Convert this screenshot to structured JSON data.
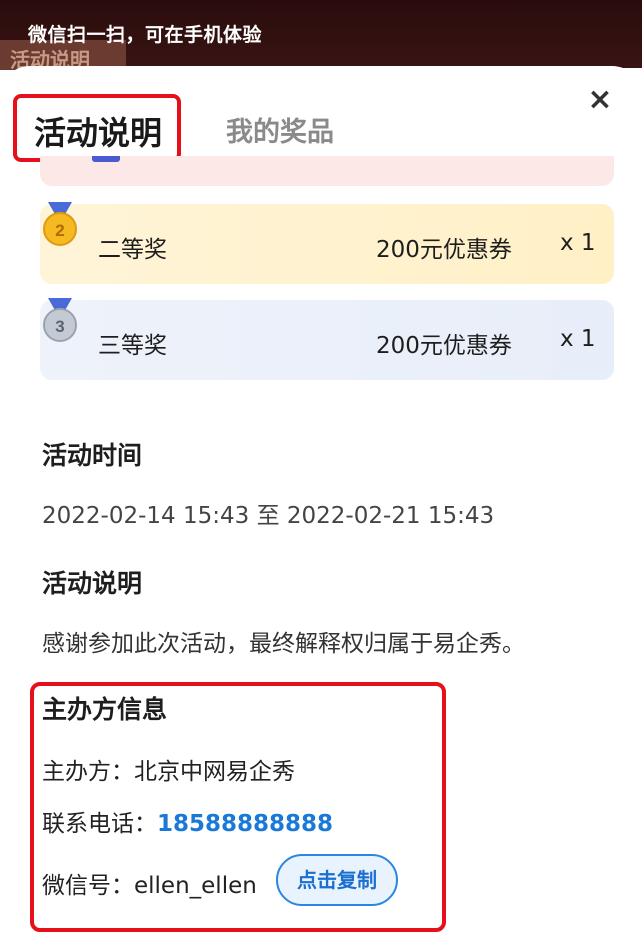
{
  "topbar": {
    "hint": "微信扫一扫，可在手机体验",
    "bg_peek": "活动说明"
  },
  "tabs": [
    {
      "label": "活动说明",
      "active": true
    },
    {
      "label": "我的奖品",
      "active": false
    }
  ],
  "close_glyph": "×",
  "prizes": [
    {
      "rank": "2",
      "name": "二等奖",
      "value": "200元优惠券",
      "qty": "x 1",
      "icon": "silver-medal-icon",
      "medal_color": "#f5b921"
    },
    {
      "rank": "3",
      "name": "三等奖",
      "value": "200元优惠券",
      "qty": "x 1",
      "icon": "bronze-medal-icon",
      "medal_color": "#b9c0cc"
    }
  ],
  "activity_time": {
    "title": "活动时间",
    "value": "2022-02-14 15:43 至 2022-02-21 15:43"
  },
  "activity_desc": {
    "title": "活动说明",
    "value": "感谢参加此次活动，最终解释权归属于易企秀。"
  },
  "host": {
    "title": "主办方信息",
    "org_label": "主办方：",
    "org_value": "北京中网易企秀",
    "phone_label": "联系电话：",
    "phone_value": "18588888888",
    "wechat_label": "微信号：",
    "wechat_value": "ellen_ellen",
    "copy_label": "点击复制"
  },
  "colors": {
    "highlight": "#e5101a",
    "link": "#1a78d6"
  }
}
